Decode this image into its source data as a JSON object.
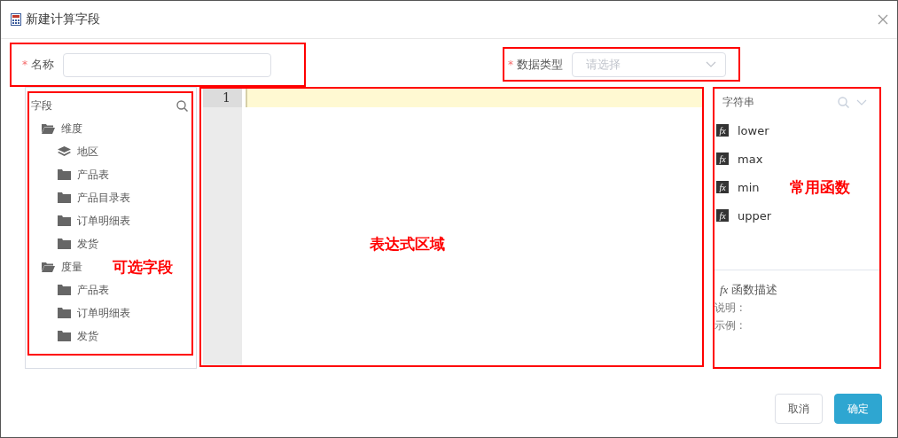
{
  "window": {
    "title": "新建计算字段"
  },
  "form": {
    "name": {
      "marker": "*",
      "label": "名称"
    },
    "data_type": {
      "marker": "*",
      "label": "数据类型",
      "placeholder": "请选择"
    }
  },
  "fields_panel": {
    "title": "字段",
    "annotation": "可选字段",
    "tree": [
      {
        "label": "维度",
        "kind": "group",
        "children": [
          {
            "label": "地区",
            "kind": "layer"
          },
          {
            "label": "产品表",
            "kind": "table"
          },
          {
            "label": "产品目录表",
            "kind": "table"
          },
          {
            "label": "订单明细表",
            "kind": "table"
          },
          {
            "label": "发货",
            "kind": "table"
          }
        ]
      },
      {
        "label": "度量",
        "kind": "group",
        "children": [
          {
            "label": "产品表",
            "kind": "table"
          },
          {
            "label": "订单明细表",
            "kind": "table"
          },
          {
            "label": "发货",
            "kind": "table"
          }
        ]
      }
    ]
  },
  "editor": {
    "line_numbers": [
      "1"
    ],
    "annotation": "表达式区域"
  },
  "functions_panel": {
    "category": "字符串",
    "annotation": "常用函数",
    "functions": [
      {
        "icon": "fx",
        "name": "lower"
      },
      {
        "icon": "fx",
        "name": "max"
      },
      {
        "icon": "fx",
        "name": "min"
      },
      {
        "icon": "fx",
        "name": "upper"
      }
    ],
    "description": {
      "icon": "fx",
      "title": "函数描述",
      "fields": [
        "说明 :",
        "示例 :"
      ]
    }
  },
  "buttons": [
    {
      "label": "取消",
      "kind": "secondary"
    },
    {
      "label": "确定",
      "kind": "primary"
    }
  ]
}
